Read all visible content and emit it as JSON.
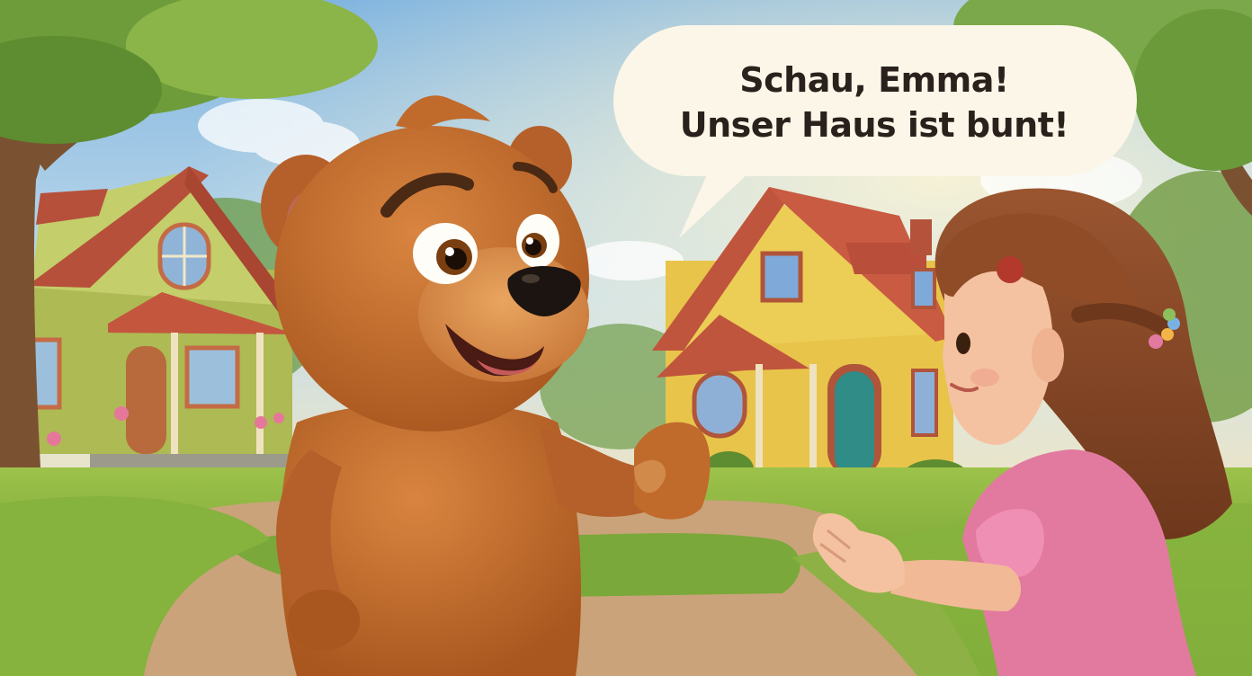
{
  "speech_bubble": {
    "line1": "Schau, Emma!",
    "line2": "Unser Haus ist bunt!"
  },
  "colors": {
    "sky": "#a9cfe8",
    "bubble": "#fbf6e8",
    "bear_fur": "#c06a2c",
    "house_yellow": "#e8c44a",
    "house_green": "#b9c65a",
    "roof": "#c0553d",
    "door": "#2f8c86",
    "girl_dress": "#e27aa0",
    "girl_hair": "#8a4a26",
    "grass": "#7aa83a",
    "path": "#caa37a"
  }
}
